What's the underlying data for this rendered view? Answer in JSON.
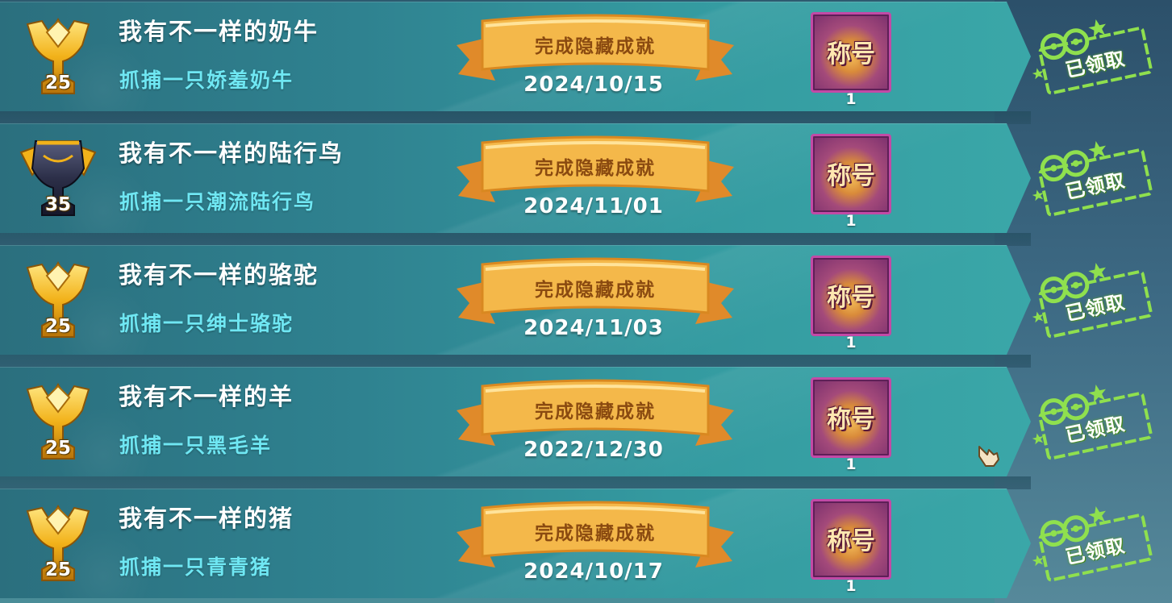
{
  "ribbon_label": "完成隐藏成就",
  "reward_label": "称号",
  "claimed_label": "已领取",
  "colors": {
    "title": "#ffffff",
    "desc": "#6fe7f3",
    "ribbon": "#f2b347",
    "claimed_stamp": "#8fe04e",
    "reward_border": "#c24aa6"
  },
  "achievements": [
    {
      "title": "我有不一样的奶牛",
      "desc": "抓捕一只娇羞奶牛",
      "date": "2024/10/15",
      "level": "25",
      "trophy": "gold-trophy-icon",
      "reward_count": "1"
    },
    {
      "title": "我有不一样的陆行鸟",
      "desc": "抓捕一只潮流陆行鸟",
      "date": "2024/11/01",
      "level": "35",
      "trophy": "dark-trophy-icon",
      "reward_count": "1"
    },
    {
      "title": "我有不一样的骆驼",
      "desc": "抓捕一只绅士骆驼",
      "date": "2024/11/03",
      "level": "25",
      "trophy": "gold-trophy-icon",
      "reward_count": "1"
    },
    {
      "title": "我有不一样的羊",
      "desc": "抓捕一只黑毛羊",
      "date": "2022/12/30",
      "level": "25",
      "trophy": "gold-trophy-icon",
      "reward_count": "1"
    },
    {
      "title": "我有不一样的猪",
      "desc": "抓捕一只青青猪",
      "date": "2024/10/17",
      "level": "25",
      "trophy": "gold-trophy-icon",
      "reward_count": "1"
    }
  ]
}
